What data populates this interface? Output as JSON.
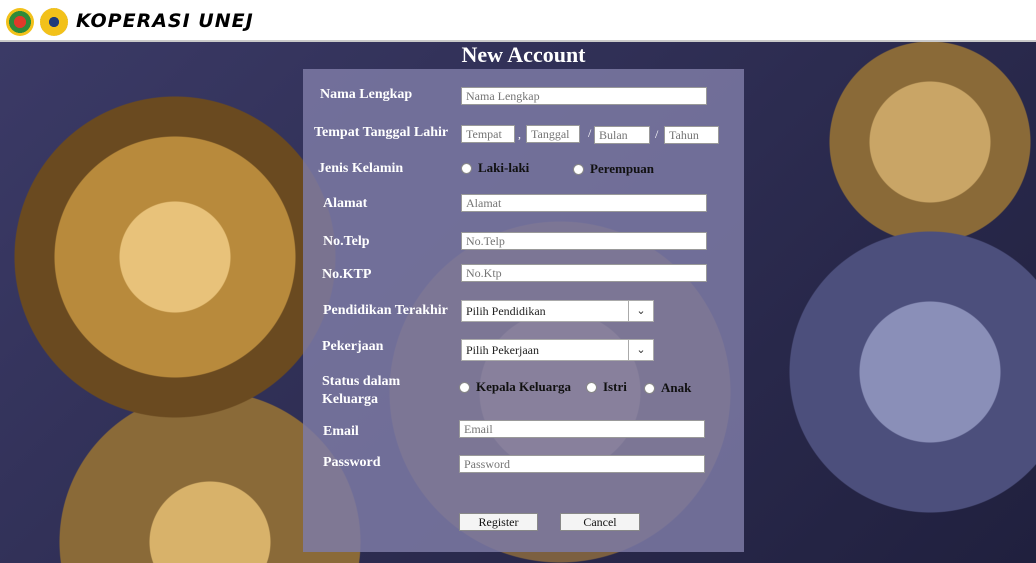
{
  "header": {
    "brand": "KOPERASI UNEJ"
  },
  "form": {
    "title": "New Account",
    "labels": {
      "nama": "Nama Lengkap",
      "ttl": "Tempat Tanggal Lahir",
      "jk": "Jenis Kelamin",
      "alamat": "Alamat",
      "telp": "No.Telp",
      "ktp": "No.KTP",
      "pendidikan": "Pendidikan Terakhir",
      "pekerjaan": "Pekerjaan",
      "status_line1": "Status dalam",
      "status_line2": "Keluarga",
      "email": "Email",
      "password": "Password"
    },
    "placeholders": {
      "nama": "Nama Lengkap",
      "tempat": "Tempat",
      "tanggal": "Tanggal",
      "bulan": "Bulan",
      "tahun": "Tahun",
      "alamat": "Alamat",
      "telp": "No.Telp",
      "ktp": "No.Ktp",
      "email": "Email",
      "password": "Password"
    },
    "separators": {
      "comma": ",",
      "slash": "/"
    },
    "gender_options": [
      "Laki-laki",
      "Perempuan"
    ],
    "pendidikan_selected": "Pilih Pendidikan",
    "pekerjaan_selected": "Pilih Pekerjaan",
    "status_options": [
      "Kepala Keluarga",
      "Istri",
      "Anak"
    ],
    "register_label": "Register",
    "cancel_label": "Cancel"
  },
  "icons": {
    "dropdown": "chevron-down-icon"
  }
}
